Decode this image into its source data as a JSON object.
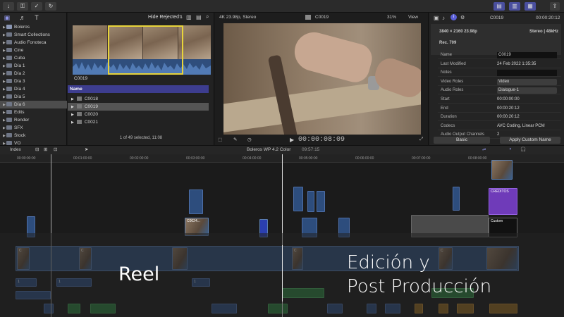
{
  "toolbar": {
    "right_icons": [
      "filmstrip-view-icon",
      "list-view-icon",
      "inspector-toggle-icon",
      "share-icon"
    ]
  },
  "sidebar": {
    "libraries": [
      {
        "label": "Boleros",
        "type": "library",
        "selected": false
      },
      {
        "label": "Smart Collections",
        "type": "folder",
        "selected": false
      },
      {
        "label": "Audio Fonoteca",
        "type": "event",
        "selected": false
      },
      {
        "label": "Cine",
        "type": "event",
        "selected": false
      },
      {
        "label": "Cuba",
        "type": "event",
        "selected": false
      },
      {
        "label": "Día 1",
        "type": "event",
        "selected": false
      },
      {
        "label": "Día 2",
        "type": "event",
        "selected": false
      },
      {
        "label": "Día 3",
        "type": "event",
        "selected": false
      },
      {
        "label": "Día 4",
        "type": "event",
        "selected": false
      },
      {
        "label": "Día 5",
        "type": "event",
        "selected": false
      },
      {
        "label": "Día 6",
        "type": "event",
        "selected": true
      },
      {
        "label": "Edits",
        "type": "event",
        "selected": false
      },
      {
        "label": "Render",
        "type": "event",
        "selected": false
      },
      {
        "label": "SFX",
        "type": "event",
        "selected": false
      },
      {
        "label": "Stock",
        "type": "event",
        "selected": false
      },
      {
        "label": "VO",
        "type": "event",
        "selected": false
      }
    ]
  },
  "browser": {
    "filter": "Hide Rejected",
    "filmstrip_clip_name": "C0019",
    "list_header": "Name",
    "clips": [
      {
        "name": "C0018",
        "selected": false
      },
      {
        "name": "C0019",
        "selected": true
      },
      {
        "name": "C0020",
        "selected": false
      },
      {
        "name": "C0021",
        "selected": false
      }
    ],
    "status": "1 of 49 selected, 11:08"
  },
  "viewer": {
    "format": "4K 23.98p, Stereo",
    "clip_name": "C0019",
    "zoom": "31%",
    "view_menu": "View",
    "timecode": "00:00:08:09"
  },
  "inspector": {
    "clip_name": "C0019",
    "duration": "00:00:20:12",
    "resolution_line": "3840 × 2160 23.98p",
    "audio_line": "Stereo | 48kHz",
    "rec_standard": "Rec. 709",
    "rows": [
      {
        "key": "Name",
        "value": "C0019",
        "kind": "field"
      },
      {
        "key": "Last Modified",
        "value": "24 Feb 2022 1:35:35",
        "kind": "text"
      },
      {
        "key": "Notes",
        "value": "",
        "kind": "field"
      },
      {
        "key": "Video Roles",
        "value": "Video",
        "kind": "popup"
      },
      {
        "key": "Audio Roles",
        "value": "Dialogue-1",
        "kind": "popup"
      },
      {
        "key": "Start",
        "value": "00:00:00:00",
        "kind": "text"
      },
      {
        "key": "End",
        "value": "00:00:20:12",
        "kind": "text"
      },
      {
        "key": "Duration",
        "value": "00:00:20:12",
        "kind": "text"
      },
      {
        "key": "Codecs",
        "value": "AVC Coding, Linear PCM",
        "kind": "text"
      },
      {
        "key": "Audio Output Channels",
        "value": "2",
        "kind": "text"
      }
    ],
    "metadata_view": "Basic",
    "apply_button": "Apply Custom Name"
  },
  "timeline": {
    "index_label": "Index",
    "project_name": "Boleros WP 4.2 Color",
    "project_duration": "09:57:15",
    "ruler": [
      "00:00:00:00",
      "00:01:00:00",
      "00:02:00:00",
      "00:03:00:00",
      "00:04:00:00",
      "00:05:00:00",
      "00:06:00:00",
      "00:07:00:00",
      "00:08:00:00"
    ],
    "clip_labels": {
      "c0024": "C0024...",
      "creditos": "CRÉDITOS",
      "custom": "Custom",
      "c": "C",
      "t1": "1"
    }
  },
  "overlay": {
    "title": "Reel",
    "subtitle_line1": "Edición y",
    "subtitle_line2": "Post Producción"
  },
  "colors": {
    "accent": "#4a4f9e",
    "selection": "#e8d43a",
    "video_clip": "#3a5f8d",
    "audio_clip": "#2c7a3d",
    "title_clip": "#6f3bb9"
  }
}
